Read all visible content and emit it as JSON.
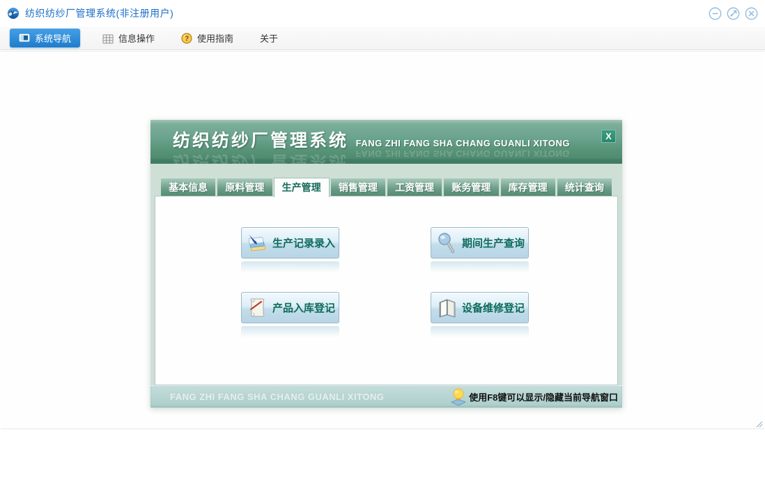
{
  "window": {
    "title": "纺织纺纱厂管理系统(非注册用户)"
  },
  "toolbar": {
    "items": [
      {
        "label": "系统导航",
        "icon": "monitor-icon",
        "active": true
      },
      {
        "label": "信息操作",
        "icon": "grid-icon",
        "active": false
      },
      {
        "label": "使用指南",
        "icon": "help-coin-icon",
        "active": false
      },
      {
        "label": "关于",
        "icon": "",
        "active": false
      }
    ]
  },
  "navigator": {
    "title": "纺织纺纱厂管理系统",
    "subtitle": "FANG ZHI FANG SHA CHANG GUANLI XITONG",
    "close_label": "X",
    "active_tab": "生产管理",
    "tabs": [
      {
        "label": "基本信息"
      },
      {
        "label": "原料管理"
      },
      {
        "label": "生产管理"
      },
      {
        "label": "销售管理"
      },
      {
        "label": "工资管理"
      },
      {
        "label": "账务管理"
      },
      {
        "label": "库存管理"
      },
      {
        "label": "统计查询"
      }
    ],
    "buttons": [
      {
        "label": "生产记录录入",
        "icon": "pen-notes-icon"
      },
      {
        "label": "期间生产查询",
        "icon": "magnifier-icon"
      },
      {
        "label": "产品入库登记",
        "icon": "scroll-pen-icon"
      },
      {
        "label": "设备维修登记",
        "icon": "open-book-icon"
      }
    ],
    "footer": {
      "watermark": "FANG ZHI FANG SHA CHANG GUANLI XITONG",
      "hint": "使用F8键可以显示/隐藏当前导航窗口"
    }
  },
  "colors": {
    "accent_blue": "#2b87d8",
    "header_green": "#69a28e",
    "tab_green": "#5e9680",
    "active_tab_text": "#156a5c",
    "button_text_green": "#0d6b5c",
    "footer_teal": "#b7d4d2",
    "title_text_blue": "#1a6ec9"
  }
}
